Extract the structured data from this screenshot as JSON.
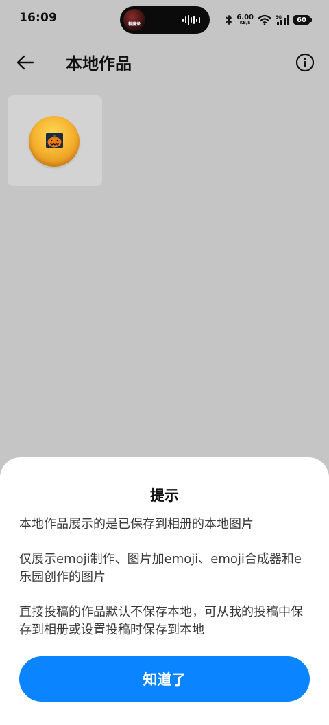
{
  "status_bar": {
    "time": "16:09",
    "island_caption": "神魔录",
    "net_speed": "6.00",
    "net_unit": "KB/S",
    "signal_label": "5G",
    "battery": "60"
  },
  "header": {
    "title": "本地作品",
    "back_icon": "arrow-left-icon",
    "info_icon": "info-circle-icon"
  },
  "artworks": [
    {
      "icon": "pumpkin-emoji"
    }
  ],
  "dialog": {
    "title": "提示",
    "paragraphs": [
      "本地作品展示的是已保存到相册的本地图片",
      "仅展示emoji制作、图片加emoji、emoji合成器和e乐园创作的图片",
      "直接投稿的作品默认不保存本地，可从我的投稿中保存到相册或设置投稿时保存到本地"
    ],
    "confirm_label": "知道了"
  },
  "colors": {
    "accent": "#0a84ff",
    "scrim_background": "#c5c5c5",
    "sheet_background": "#ffffff"
  }
}
